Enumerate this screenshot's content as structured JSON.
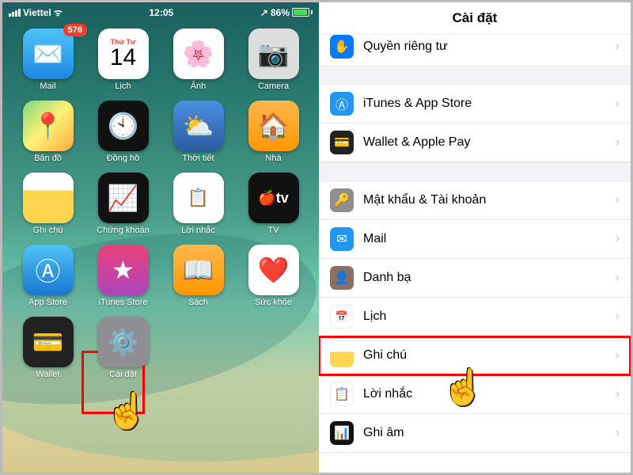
{
  "status": {
    "carrier": "Viettel",
    "wifi": "ᯤ",
    "time": "12:05",
    "battery_pct": "86%",
    "arrow": "↗"
  },
  "apps": [
    {
      "name": "Mail",
      "badge": "576"
    },
    {
      "name": "Lịch",
      "day": "Thứ Tư",
      "num": "14"
    },
    {
      "name": "Ảnh"
    },
    {
      "name": "Camera"
    },
    {
      "name": "Bản đồ"
    },
    {
      "name": "Đồng hồ"
    },
    {
      "name": "Thời tiết"
    },
    {
      "name": "Nhà"
    },
    {
      "name": "Ghi chú"
    },
    {
      "name": "Chứng khoán"
    },
    {
      "name": "Lời nhắc"
    },
    {
      "name": "TV"
    },
    {
      "name": "App Store"
    },
    {
      "name": "iTunes Store"
    },
    {
      "name": "Sách"
    },
    {
      "name": "Sức khỏe"
    },
    {
      "name": "Wallet"
    },
    {
      "name": "Cài đặt"
    }
  ],
  "settings": {
    "title": "Cài đặt",
    "rows": [
      {
        "label": "Quyền riêng tư"
      },
      {
        "label": "iTunes & App Store"
      },
      {
        "label": "Wallet & Apple Pay"
      },
      {
        "label": "Mật khẩu & Tài khoản"
      },
      {
        "label": "Mail"
      },
      {
        "label": "Danh bạ"
      },
      {
        "label": "Lịch"
      },
      {
        "label": "Ghi chú"
      },
      {
        "label": "Lời nhắc"
      },
      {
        "label": "Ghi âm"
      }
    ]
  },
  "hand": "☝️"
}
